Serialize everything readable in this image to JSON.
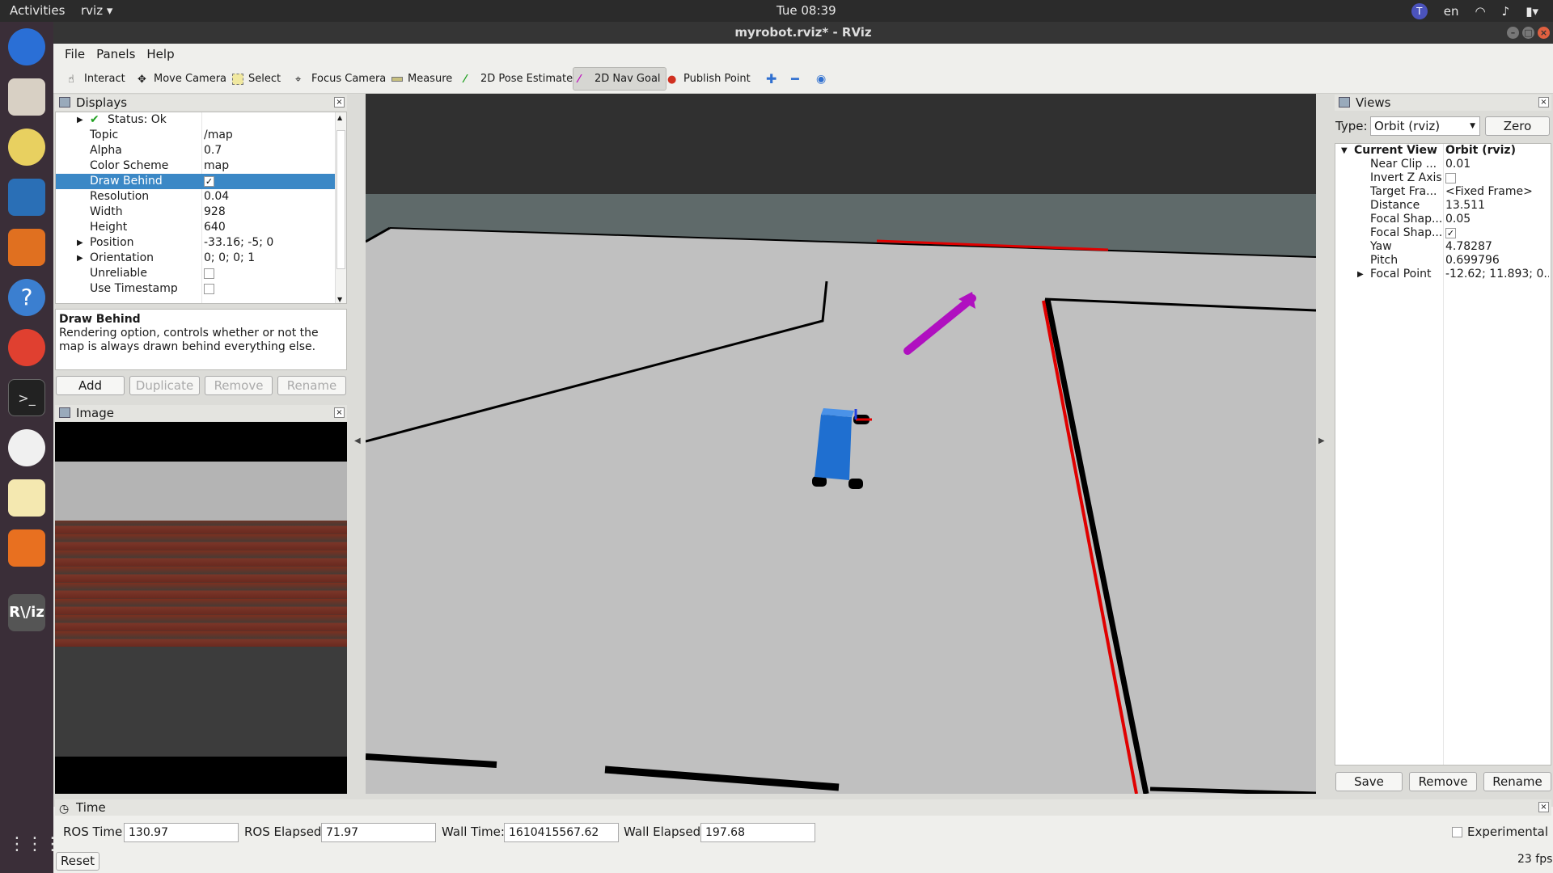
{
  "topbar": {
    "activities": "Activities",
    "app_name": "rviz",
    "app_icon_text": "R\\/iz",
    "clock": "Tue 08:39",
    "lang": "en"
  },
  "window": {
    "title": "myrobot.rviz* - RViz"
  },
  "menu": {
    "file": "File",
    "panels": "Panels",
    "help": "Help"
  },
  "toolbar": {
    "interact": "Interact",
    "move_camera": "Move Camera",
    "select": "Select",
    "focus_camera": "Focus Camera",
    "measure": "Measure",
    "pose_estimate": "2D Pose Estimate",
    "nav_goal": "2D Nav Goal",
    "publish_point": "Publish Point"
  },
  "displays": {
    "title": "Displays",
    "rows": [
      {
        "key": "Status: Ok",
        "value": ""
      },
      {
        "key": "Topic",
        "value": "/map"
      },
      {
        "key": "Alpha",
        "value": "0.7"
      },
      {
        "key": "Color Scheme",
        "value": "map"
      },
      {
        "key": "Draw Behind",
        "value": "✓"
      },
      {
        "key": "Resolution",
        "value": "0.04"
      },
      {
        "key": "Width",
        "value": "928"
      },
      {
        "key": "Height",
        "value": "640"
      },
      {
        "key": "Position",
        "value": "-33.16; -5; 0"
      },
      {
        "key": "Orientation",
        "value": "0; 0; 0; 1"
      },
      {
        "key": "Unreliable",
        "value": ""
      },
      {
        "key": "Use Timestamp",
        "value": ""
      }
    ],
    "desc_title": "Draw Behind",
    "desc_text": "Rendering option, controls whether or not the map is always drawn behind everything else.",
    "btn_add": "Add",
    "btn_duplicate": "Duplicate",
    "btn_remove": "Remove",
    "btn_rename": "Rename"
  },
  "image_panel": {
    "title": "Image"
  },
  "views": {
    "title": "Views",
    "type_label": "Type:",
    "type_value": "Orbit (rviz)",
    "zero": "Zero",
    "rows": [
      {
        "key": "Current View",
        "value": "Orbit (rviz)"
      },
      {
        "key": "Near Clip ...",
        "value": "0.01"
      },
      {
        "key": "Invert Z Axis",
        "value": ""
      },
      {
        "key": "Target Fra...",
        "value": "<Fixed Frame>"
      },
      {
        "key": "Distance",
        "value": "13.511"
      },
      {
        "key": "Focal Shap...",
        "value": "0.05"
      },
      {
        "key": "Focal Shap...",
        "value": "✓"
      },
      {
        "key": "Yaw",
        "value": "4.78287"
      },
      {
        "key": "Pitch",
        "value": "0.699796"
      },
      {
        "key": "Focal Point",
        "value": "-12.62; 11.893; 0..."
      }
    ],
    "btn_save": "Save",
    "btn_remove": "Remove",
    "btn_rename": "Rename"
  },
  "time": {
    "title": "Time",
    "ros_time_label": "ROS Time:",
    "ros_time": "130.97",
    "ros_elapsed_label": "ROS Elapsed:",
    "ros_elapsed": "71.97",
    "wall_time_label": "Wall Time:",
    "wall_time": "1610415567.62",
    "wall_elapsed_label": "Wall Elapsed:",
    "wall_elapsed": "197.68",
    "experimental": "Experimental",
    "reset": "Reset",
    "fps": "23 fps"
  },
  "colors": {
    "selection": "#3b88c6",
    "goal_arrow": "#b010c0",
    "robot": "#1f6fd0",
    "floor": "#c0c0c0"
  }
}
